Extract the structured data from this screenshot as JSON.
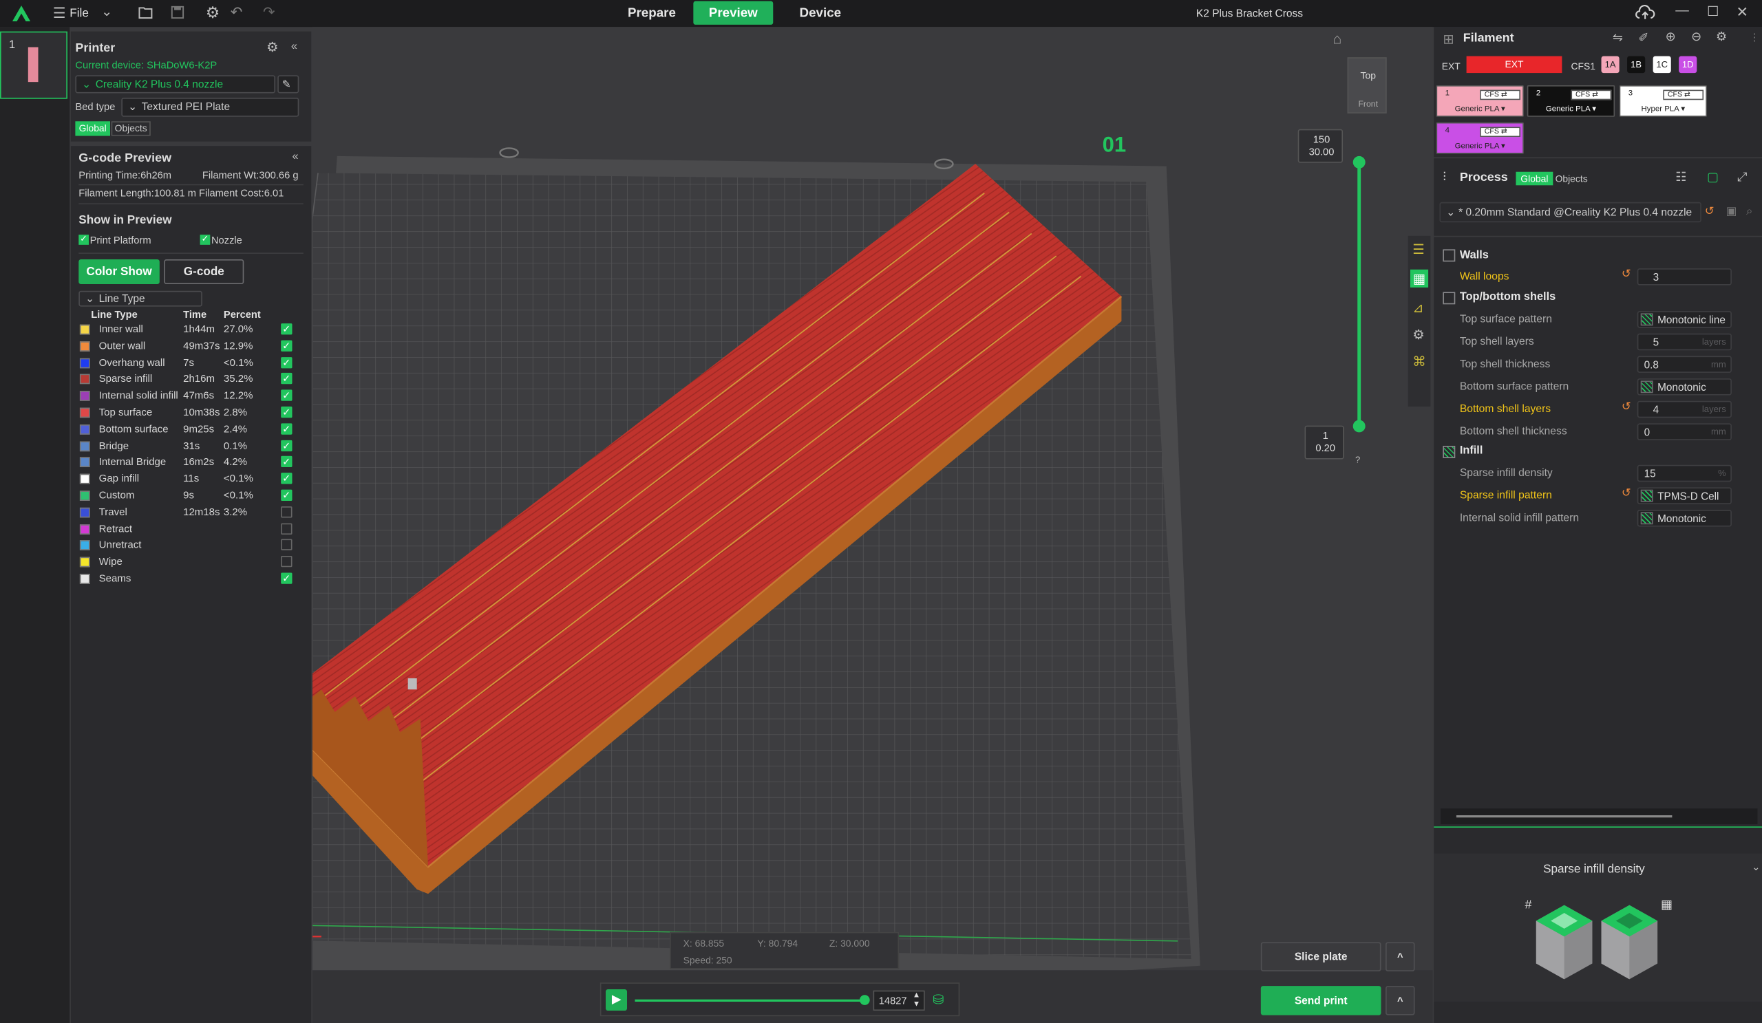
{
  "app": {
    "menu_file": "File",
    "tabs": [
      "Prepare",
      "Preview",
      "Device"
    ],
    "active_tab": "Preview",
    "window_title": "K2 Plus Bracket Cross"
  },
  "plate": {
    "number": "1",
    "label": "01"
  },
  "printer": {
    "title": "Printer",
    "current_device": "Current device: SHaDoW6-K2P",
    "preset": "Creality K2 Plus 0.4 nozzle",
    "bed_type_label": "Bed type",
    "bed_type": "Textured PEI Plate",
    "global": "Global",
    "objects": "Objects"
  },
  "gcode": {
    "title": "G-code Preview",
    "printing_time": "Printing Time:6h26m",
    "filament_weight": "Filament Wt:300.66 g",
    "filament_length": "Filament Length:100.81 m",
    "filament_cost": "Filament Cost:6.01",
    "show_in_preview": "Show in Preview",
    "print_platform": "Print Platform",
    "nozzle": "Nozzle",
    "color_show": "Color Show",
    "gcode_btn": "G-code",
    "view_type": "Line Type",
    "headers": [
      "Line Type",
      "Time",
      "Percent"
    ],
    "lines": [
      {
        "name": "Inner wall",
        "time": "1h44m",
        "percent": "27.0%",
        "color": "#f5d547",
        "checked": true
      },
      {
        "name": "Outer wall",
        "time": "49m37s",
        "percent": "12.9%",
        "color": "#f08a3c",
        "checked": true
      },
      {
        "name": "Overhang wall",
        "time": "7s",
        "percent": "<0.1%",
        "color": "#1f3cf0",
        "checked": true
      },
      {
        "name": "Sparse infill",
        "time": "2h16m",
        "percent": "35.2%",
        "color": "#b83a34",
        "checked": true
      },
      {
        "name": "Internal solid infill",
        "time": "47m6s",
        "percent": "12.2%",
        "color": "#9b3fb5",
        "checked": true
      },
      {
        "name": "Top surface",
        "time": "10m38s",
        "percent": "2.8%",
        "color": "#e04848",
        "checked": true
      },
      {
        "name": "Bottom surface",
        "time": "9m25s",
        "percent": "2.4%",
        "color": "#5060d8",
        "checked": true
      },
      {
        "name": "Bridge",
        "time": "31s",
        "percent": "0.1%",
        "color": "#5a86c8",
        "checked": true
      },
      {
        "name": "Internal Bridge",
        "time": "16m2s",
        "percent": "4.2%",
        "color": "#5a86c8",
        "checked": true
      },
      {
        "name": "Gap infill",
        "time": "11s",
        "percent": "<0.1%",
        "color": "#ffffff",
        "checked": true
      },
      {
        "name": "Custom",
        "time": "9s",
        "percent": "<0.1%",
        "color": "#2fbf71",
        "checked": true
      },
      {
        "name": "Travel",
        "time": "12m18s",
        "percent": "3.2%",
        "color": "#3a4fd6",
        "checked": false
      },
      {
        "name": "Retract",
        "time": "",
        "percent": "",
        "color": "#d33ad3",
        "checked": false
      },
      {
        "name": "Unretract",
        "time": "",
        "percent": "",
        "color": "#3aaee8",
        "checked": false
      },
      {
        "name": "Wipe",
        "time": "",
        "percent": "",
        "color": "#f5e62a",
        "checked": false
      },
      {
        "name": "Seams",
        "time": "",
        "percent": "",
        "color": "#e8e8e8",
        "checked": true
      }
    ]
  },
  "viewport": {
    "view_top": "Top",
    "view_front": "Front",
    "layer_top": "150",
    "layer_top_z": "30.00",
    "layer_bottom": "1",
    "layer_bottom_z": "0.20",
    "help": "?",
    "coord_x": "X: 68.855",
    "coord_y": "Y: 80.794",
    "coord_z": "Z: 30.000",
    "speed": "Speed: 250",
    "move_count": "14827",
    "slice_plate": "Slice plate",
    "send_print": "Send print",
    "caret": "^",
    "slider_position": 0.99
  },
  "filament": {
    "title": "Filament",
    "ext": "EXT",
    "ext_chip": "EXT",
    "cfs1": "CFS1",
    "slots": [
      "1A",
      "1B",
      "1C",
      "1D"
    ],
    "slot_colors": [
      "#f4a6b8",
      "#111111",
      "#ffffff",
      "#c94fe6"
    ],
    "items": [
      {
        "num": "1",
        "cfs": "CFS ⇄",
        "type": "Generic PLA ▾",
        "color": "#f4a6b8"
      },
      {
        "num": "2",
        "cfs": "CFS ⇄",
        "type": "Generic PLA ▾",
        "color": "#111111"
      },
      {
        "num": "3",
        "cfs": "CFS ⇄",
        "type": "Hyper PLA ▾",
        "color": "#ffffff"
      },
      {
        "num": "4",
        "cfs": "CFS ⇄",
        "type": "Generic PLA ▾",
        "color": "#c94fe6"
      }
    ]
  },
  "process": {
    "title": "Process",
    "global": "Global",
    "objects": "Objects",
    "preset": "* 0.20mm Standard @Creality K2 Plus 0.4 nozzle",
    "walls": "Walls",
    "wall_loops_label": "Wall loops",
    "wall_loops": "3",
    "top_bottom": "Top/bottom shells",
    "top_surface_pattern_label": "Top surface pattern",
    "top_surface_pattern": "Monotonic line",
    "top_shell_layers_label": "Top shell layers",
    "top_shell_layers": "5",
    "layers_unit": "layers",
    "top_shell_thickness_label": "Top shell thickness",
    "top_shell_thickness": "0.8",
    "mm_unit": "mm",
    "bottom_surface_pattern_label": "Bottom surface pattern",
    "bottom_surface_pattern": "Monotonic",
    "bottom_shell_layers_label": "Bottom shell layers",
    "bottom_shell_layers": "4",
    "bottom_shell_thickness_label": "Bottom shell thickness",
    "bottom_shell_thickness": "0",
    "infill": "Infill",
    "sparse_density_label": "Sparse infill density",
    "sparse_density": "15",
    "pct_unit": "%",
    "sparse_pattern_label": "Sparse infill pattern",
    "sparse_pattern": "TPMS-D Cell",
    "internal_solid_label": "Internal solid infill pattern",
    "internal_solid": "Monotonic",
    "tip_title": "Sparse infill density"
  }
}
